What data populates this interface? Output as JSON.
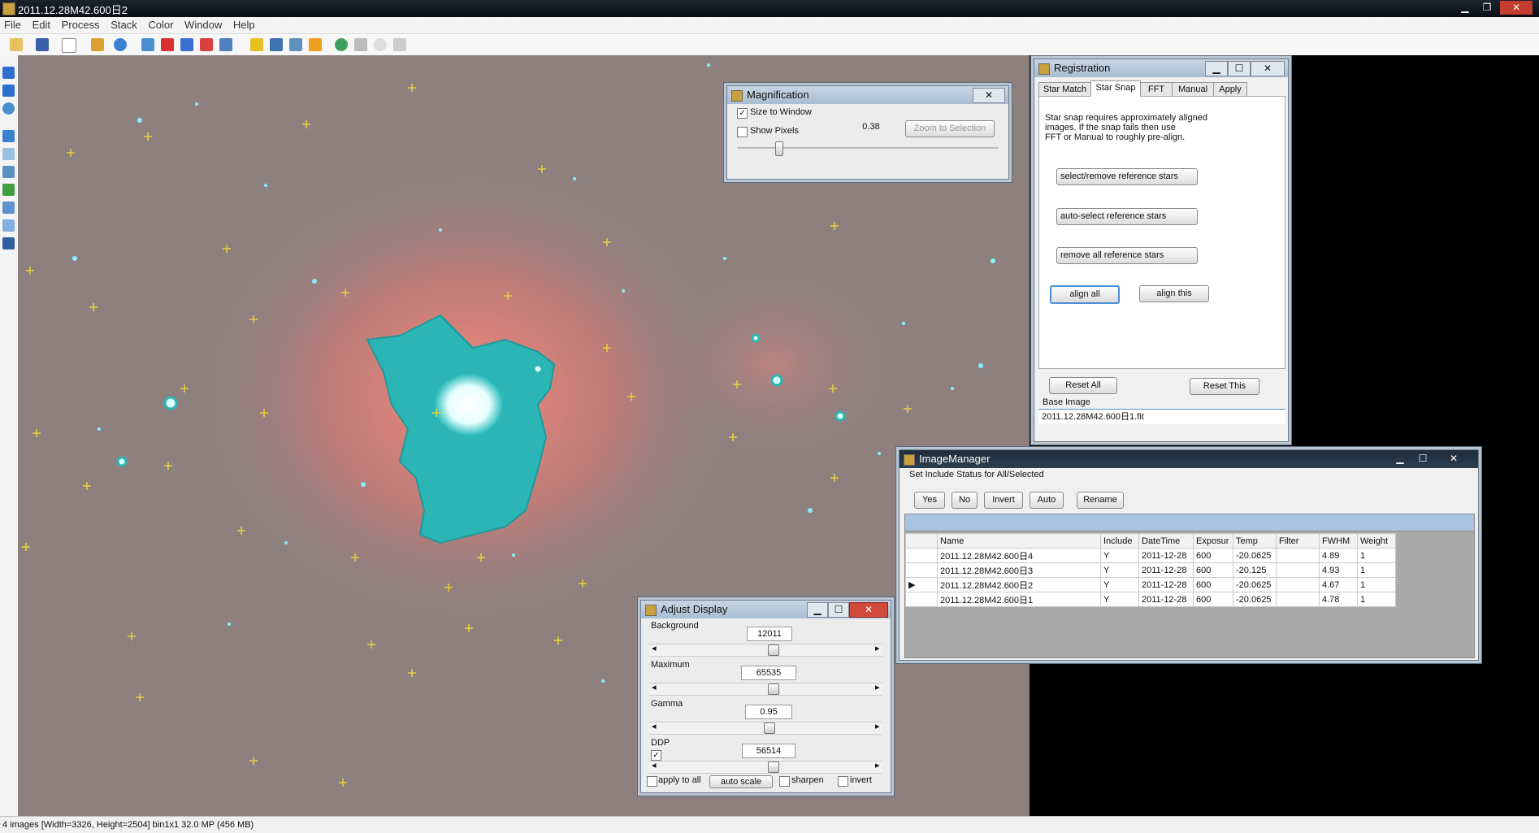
{
  "window": {
    "title": "2011.12.28M42.600日2",
    "minimize": "▁",
    "restore": "❐",
    "close": "✕"
  },
  "menu": [
    "File",
    "Edit",
    "Process",
    "Stack",
    "Color",
    "Window",
    "Help"
  ],
  "status_bar": "4 images  [Width=3326, Height=2504] bin1x1  32.0 MP (456 MB)",
  "magnification": {
    "title": "Magnification",
    "size_to_window_label": "Size to Window",
    "size_to_window_checked": "✓",
    "show_pixels_label": "Show Pixels",
    "zoom_value": "0.38",
    "zoom_to_selection": "Zoom to Selection",
    "slider_value": 0.15,
    "close": "✕"
  },
  "registration": {
    "title": "Registration",
    "tabs": [
      "Star Match",
      "Star Snap",
      "FFT",
      "Manual",
      "Apply"
    ],
    "active_tab": "Star Snap",
    "description_lines": [
      "Star snap requires approximately aligned",
      "images. If the snap fails then use",
      "FFT or Manual to roughly pre-align."
    ],
    "select_remove": "select/remove reference stars",
    "auto_select": "auto-select reference stars",
    "remove_all": "remove all reference stars",
    "align_all": "align all",
    "align_this": "align this",
    "reset_all": "Reset All",
    "reset_this": "Reset This",
    "base_image_label": "Base Image",
    "base_image_value": "2011.12.28M42.600日1.fit",
    "minimize": "▁",
    "maximize": "☐",
    "close": "✕"
  },
  "image_manager": {
    "title": "ImageManager",
    "set_include_label": "Set Include Status for All/Selected",
    "buttons": {
      "yes": "Yes",
      "no": "No",
      "invert": "Invert",
      "auto": "Auto",
      "rename": "Rename"
    },
    "columns": [
      "Name",
      "Include",
      "DateTime",
      "Exposur",
      "Temp",
      "Filter",
      "FWHM",
      "Weight"
    ],
    "rows": [
      {
        "marker": "",
        "name": "2011.12.28M42.600日4",
        "include": "Y",
        "datetime": "2011-12-28",
        "exposure": "600",
        "temp": "-20.0625",
        "filter": "",
        "fwhm": "4.89",
        "weight": "1"
      },
      {
        "marker": "",
        "name": "2011.12.28M42.600日3",
        "include": "Y",
        "datetime": "2011-12-28",
        "exposure": "600",
        "temp": "-20.125",
        "filter": "",
        "fwhm": "4.93",
        "weight": "1"
      },
      {
        "marker": "▶",
        "name": "2011.12.28M42.600日2",
        "include": "Y",
        "datetime": "2011-12-28",
        "exposure": "600",
        "temp": "-20.0625",
        "filter": "",
        "fwhm": "4.67",
        "weight": "1"
      },
      {
        "marker": "",
        "name": "2011.12.28M42.600日1",
        "include": "Y",
        "datetime": "2011-12-28",
        "exposure": "600",
        "temp": "-20.0625",
        "filter": "",
        "fwhm": "4.78",
        "weight": "1"
      }
    ],
    "minimize": "▁",
    "maximize": "☐",
    "close": "✕"
  },
  "adjust_display": {
    "title": "Adjust Display",
    "background_label": "Background",
    "background_value": "12011",
    "background_slider": 0.52,
    "maximum_label": "Maximum",
    "maximum_value": "65535",
    "maximum_slider": 0.52,
    "gamma_label": "Gamma",
    "gamma_value": "0.95",
    "gamma_slider": 0.5,
    "ddp_label": "DDP",
    "ddp_checked": "✓",
    "ddp_value": "56514",
    "ddp_slider": 0.52,
    "apply_to_all": "apply to all",
    "auto_scale": "auto scale",
    "sharpen": "sharpen",
    "invert": "invert",
    "arrow_left": "◂",
    "arrow_right": "▸",
    "minimize": "▁",
    "maximize": "☐",
    "close": "✕"
  },
  "colors": {
    "accent_cyan": "#29b8b8",
    "star_marker": "#e6d23a",
    "background_sky": "#8f8080"
  }
}
